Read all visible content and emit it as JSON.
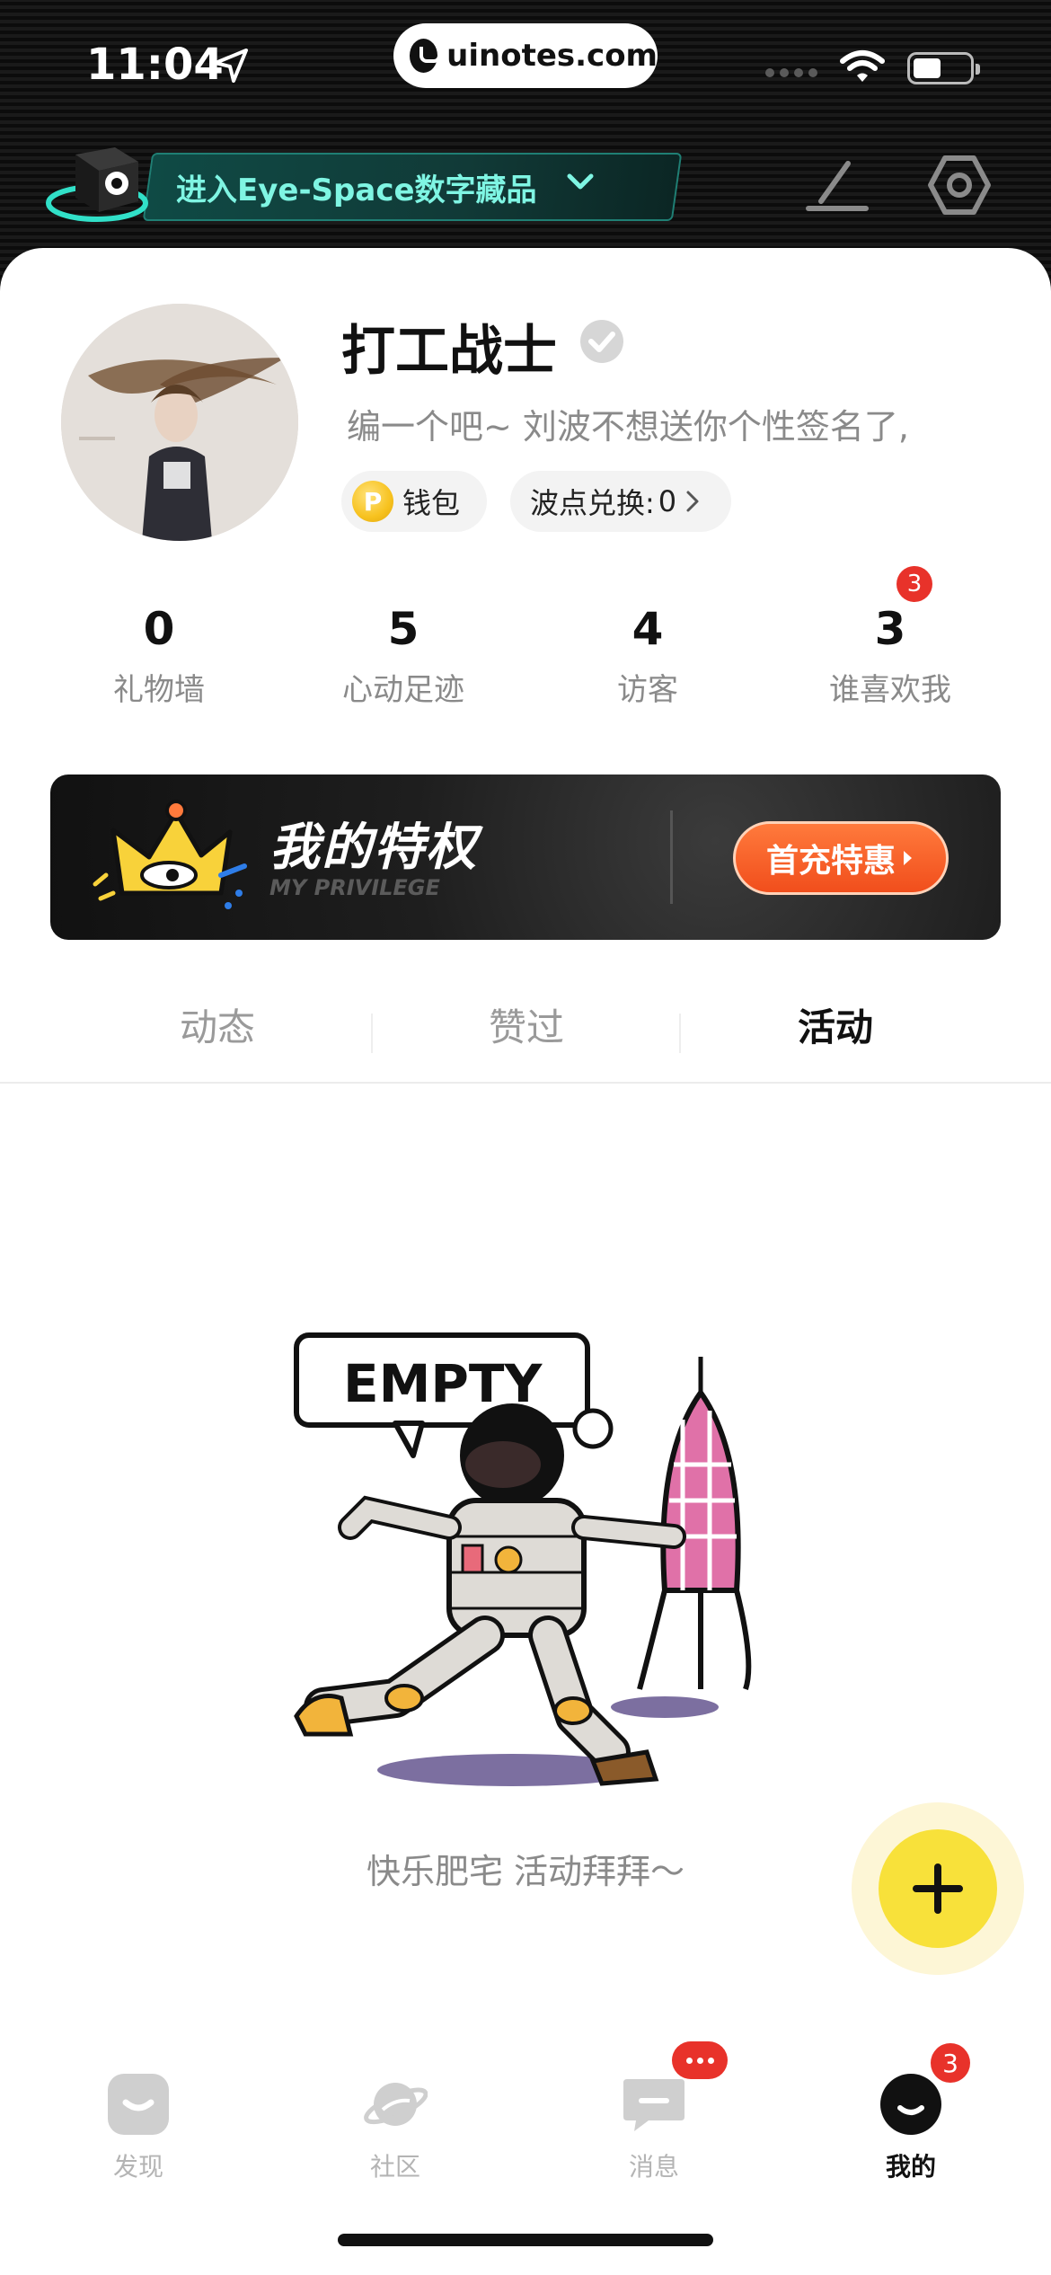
{
  "status_bar": {
    "time": "11:04",
    "url": "uinotes.com"
  },
  "header": {
    "eye_space_label": "进入Eye-Space数字藏品"
  },
  "profile": {
    "username": "打工战士",
    "signature": "编一个吧~      刘波不想送你个性签名了,",
    "wallet_label": "钱包",
    "coin_symbol": "P",
    "points_label": "波点兑换:",
    "points_value": "0"
  },
  "stats": [
    {
      "value": "0",
      "label": "礼物墙"
    },
    {
      "value": "5",
      "label": "心动足迹"
    },
    {
      "value": "4",
      "label": "访客"
    },
    {
      "value": "3",
      "label": "谁喜欢我"
    }
  ],
  "stats_badge": "3",
  "privilege": {
    "title": "我的特权",
    "subtitle": "MY PRIVILEGE",
    "button": "首充特惠"
  },
  "tabs": [
    {
      "label": "动态"
    },
    {
      "label": "赞过"
    },
    {
      "label": "活动"
    }
  ],
  "active_tab": "活动",
  "empty": {
    "illustration_text": "EMPTY",
    "message": "快乐肥宅 活动拜拜～"
  },
  "tabbar": [
    {
      "label": "发现",
      "icon": "discover-icon"
    },
    {
      "label": "社区",
      "icon": "planet-icon"
    },
    {
      "label": "消息",
      "icon": "message-icon"
    },
    {
      "label": "我的",
      "icon": "me-icon"
    }
  ],
  "tabbar_me_badge": "3",
  "colors": {
    "accent_yellow": "#f8e13a",
    "badge_red": "#e8322a",
    "eye_space_cyan": "#7ff5e3",
    "promo_orange": "#f14e1c"
  }
}
